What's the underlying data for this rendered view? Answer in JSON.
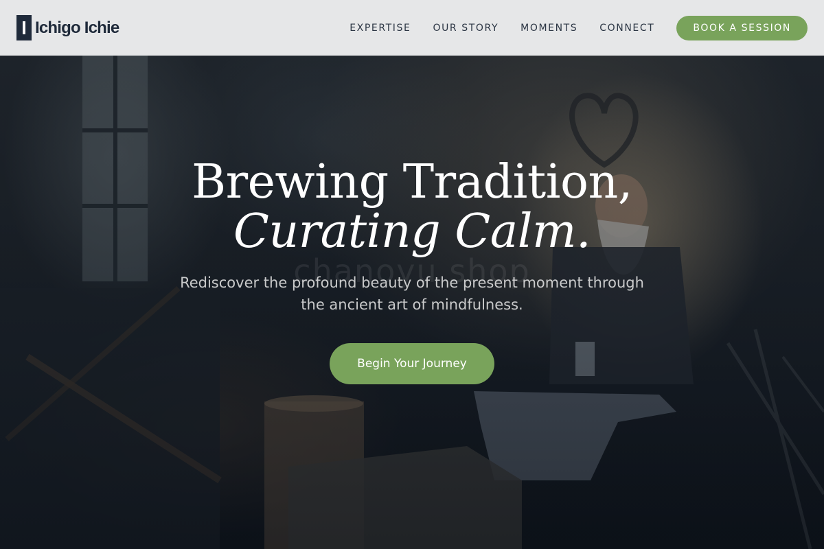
{
  "brand": {
    "name": "Ichigo Ichie",
    "logo_icon": "brand-mark-icon"
  },
  "nav": {
    "links": [
      "EXPERTISE",
      "OUR STORY",
      "MOMENTS",
      "CONNECT"
    ],
    "cta_label": "BOOK A SESSION"
  },
  "hero": {
    "title_line1": "Brewing Tradition,",
    "title_line2": "Curating Calm.",
    "watermark": "chanoyu shop",
    "subtitle": "Rediscover the profound beauty of the present moment through the ancient art of mindfulness.",
    "cta_label": "Begin Your Journey"
  },
  "colors": {
    "accent": "#79a35b",
    "navy": "#1f2a3a",
    "navbar_bg": "#ecedee"
  }
}
